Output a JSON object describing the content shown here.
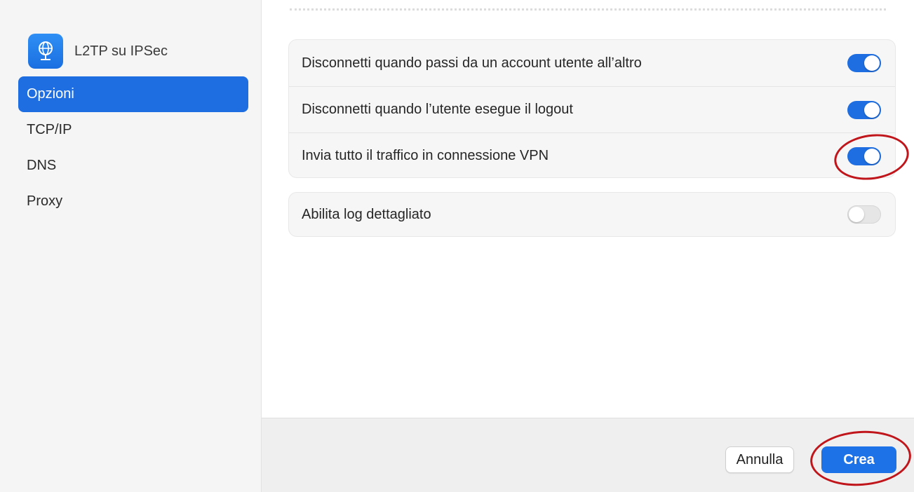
{
  "sidebar": {
    "vpn_title": "L2TP su IPSec",
    "vpn_icon": "globe-network-icon",
    "items": [
      {
        "label": "Opzioni",
        "active": true
      },
      {
        "label": "TCP/IP",
        "active": false
      },
      {
        "label": "DNS",
        "active": false
      },
      {
        "label": "Proxy",
        "active": false
      }
    ]
  },
  "options": {
    "group1": [
      {
        "label": "Disconnetti quando passi da un account utente all’altro",
        "enabled": true
      },
      {
        "label": "Disconnetti quando l’utente esegue il logout",
        "enabled": true
      },
      {
        "label": "Invia tutto il traffico in connessione VPN",
        "enabled": true,
        "highlighted": true
      }
    ],
    "group2": [
      {
        "label": "Abilita log dettagliato",
        "enabled": false
      }
    ]
  },
  "footer": {
    "cancel_label": "Annulla",
    "create_label": "Crea"
  },
  "colors": {
    "accent": "#1e6ee1",
    "highlight_ring": "#c0161b"
  }
}
